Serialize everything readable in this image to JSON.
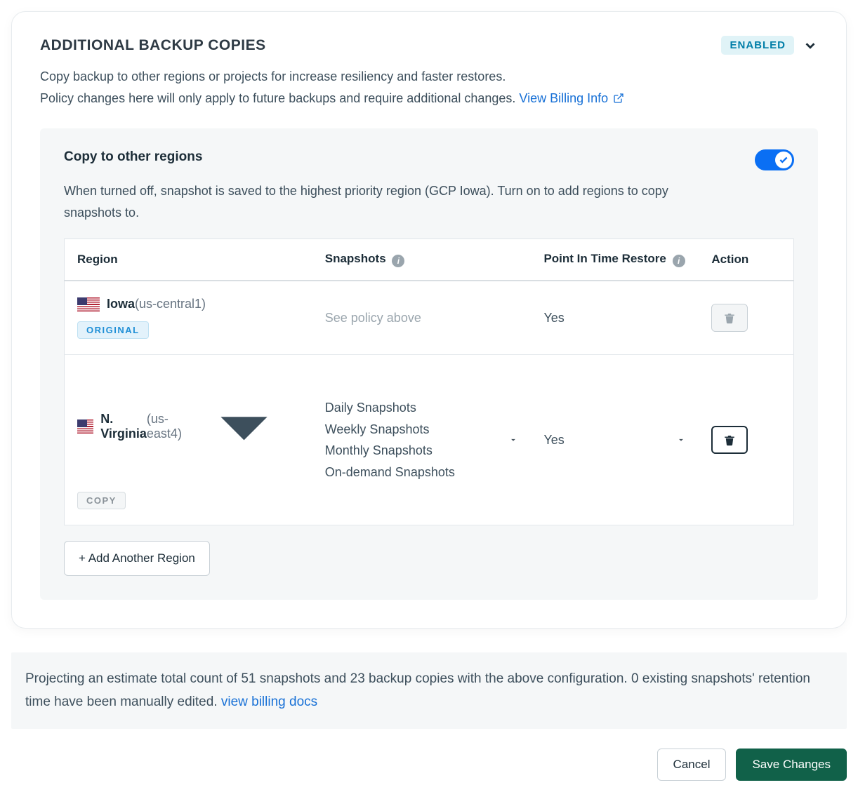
{
  "header": {
    "title": "ADDITIONAL BACKUP COPIES",
    "enabled_badge": "ENABLED"
  },
  "description": {
    "line1": "Copy backup to other regions or projects for increase resiliency and faster restores.",
    "line2": "Policy changes here will only apply to future backups and require additional changes. ",
    "link": "View Billing Info"
  },
  "panel": {
    "title": "Copy to other regions",
    "description": "When turned off, snapshot is saved to the highest priority region (GCP Iowa). Turn on to add regions to copy snapshots to.",
    "toggle_on": true
  },
  "table": {
    "columns": {
      "region": "Region",
      "snapshots": "Snapshots",
      "pit": "Point In Time Restore",
      "action": "Action"
    },
    "rows": [
      {
        "name": "Iowa",
        "code": "(us-central1)",
        "tag": "ORIGINAL",
        "tag_class": "tag-original",
        "snapshots_text": "See policy above",
        "snapshots_muted": true,
        "snapshots_list": null,
        "pit": "Yes",
        "region_dropdown": false,
        "pit_dropdown": false,
        "trash_active": false
      },
      {
        "name": "N. Virginia",
        "code": "(us-east4)",
        "tag": "COPY",
        "tag_class": "tag-copy",
        "snapshots_text": null,
        "snapshots_muted": false,
        "snapshots_list": [
          "Daily Snapshots",
          "Weekly Snapshots",
          "Monthly Snapshots",
          "On-demand Snapshots"
        ],
        "pit": "Yes",
        "region_dropdown": true,
        "pit_dropdown": true,
        "trash_active": true
      }
    ],
    "add_region": "+ Add Another Region"
  },
  "projection": {
    "text": "Projecting an estimate total count of 51 snapshots and 23 backup copies with the above configuration. 0 existing snapshots' retention time have been manually edited.  ",
    "link": "view billing docs"
  },
  "footer": {
    "cancel": "Cancel",
    "save": "Save Changes"
  }
}
